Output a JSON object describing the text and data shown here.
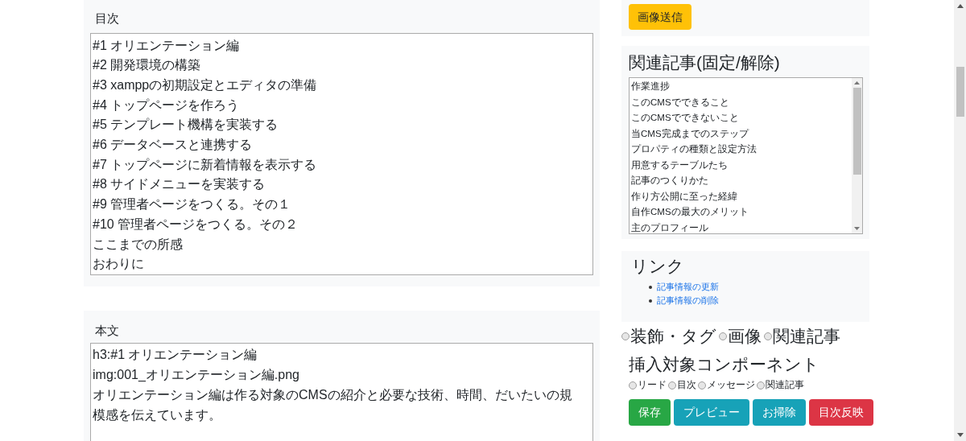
{
  "toc": {
    "label": "目次",
    "lines": [
      "#1 オリエンテーション編",
      "#2 開発環境の構築",
      "#3 xamppの初期設定とエディタの準備",
      "#4 トップページを作ろう",
      "#5 テンプレート機構を実装する",
      "#6 データベースと連携する",
      "#7 トップページに新着情報を表示する",
      "#8 サイドメニューを実装する",
      "#9 管理者ページをつくる。その１",
      "#10 管理者ページをつくる。その２",
      "ここまでの所感",
      "おわりに"
    ]
  },
  "body": {
    "label": "本文",
    "lines": [
      "h3:#1 オリエンテーション編",
      "img:001_オリエンテーション編.png",
      "オリエンテーション編は作る対象のCMSの紹介と必要な技術、時間、だいたいの規模感を伝えています。"
    ]
  },
  "image_upload": {
    "button": "画像送信"
  },
  "related": {
    "title": "関連記事(固定/解除)",
    "items": [
      "作業進捗",
      "このCMSでできること",
      "このCMSでできないこと",
      "当CMS完成までのステップ",
      "プロパティの種類と設定方法",
      "用意するテーブルたち",
      "記事のつくりかた",
      "作り方公開に至った経緯",
      "自作CMSの最大のメリット",
      "主のプロフィール"
    ]
  },
  "links": {
    "title": "リンク",
    "items": [
      "記事情報の更新",
      "記事情報の削除"
    ]
  },
  "insert_type": [
    {
      "label": "装飾・タグ",
      "checked": false
    },
    {
      "label": "画像",
      "checked": false
    },
    {
      "label": "関連記事",
      "checked": false
    }
  ],
  "component": {
    "title": "挿入対象コンポーネント",
    "options": [
      {
        "label": "リード",
        "checked": false
      },
      {
        "label": "目次",
        "checked": false
      },
      {
        "label": "メッセージ",
        "checked": false
      },
      {
        "label": "関連記事",
        "checked": false
      }
    ]
  },
  "actions": [
    {
      "label": "保存",
      "kind": "success"
    },
    {
      "label": "プレビュー",
      "kind": "info"
    },
    {
      "label": "お掃除",
      "kind": "info"
    },
    {
      "label": "目次反映",
      "kind": "danger"
    }
  ]
}
